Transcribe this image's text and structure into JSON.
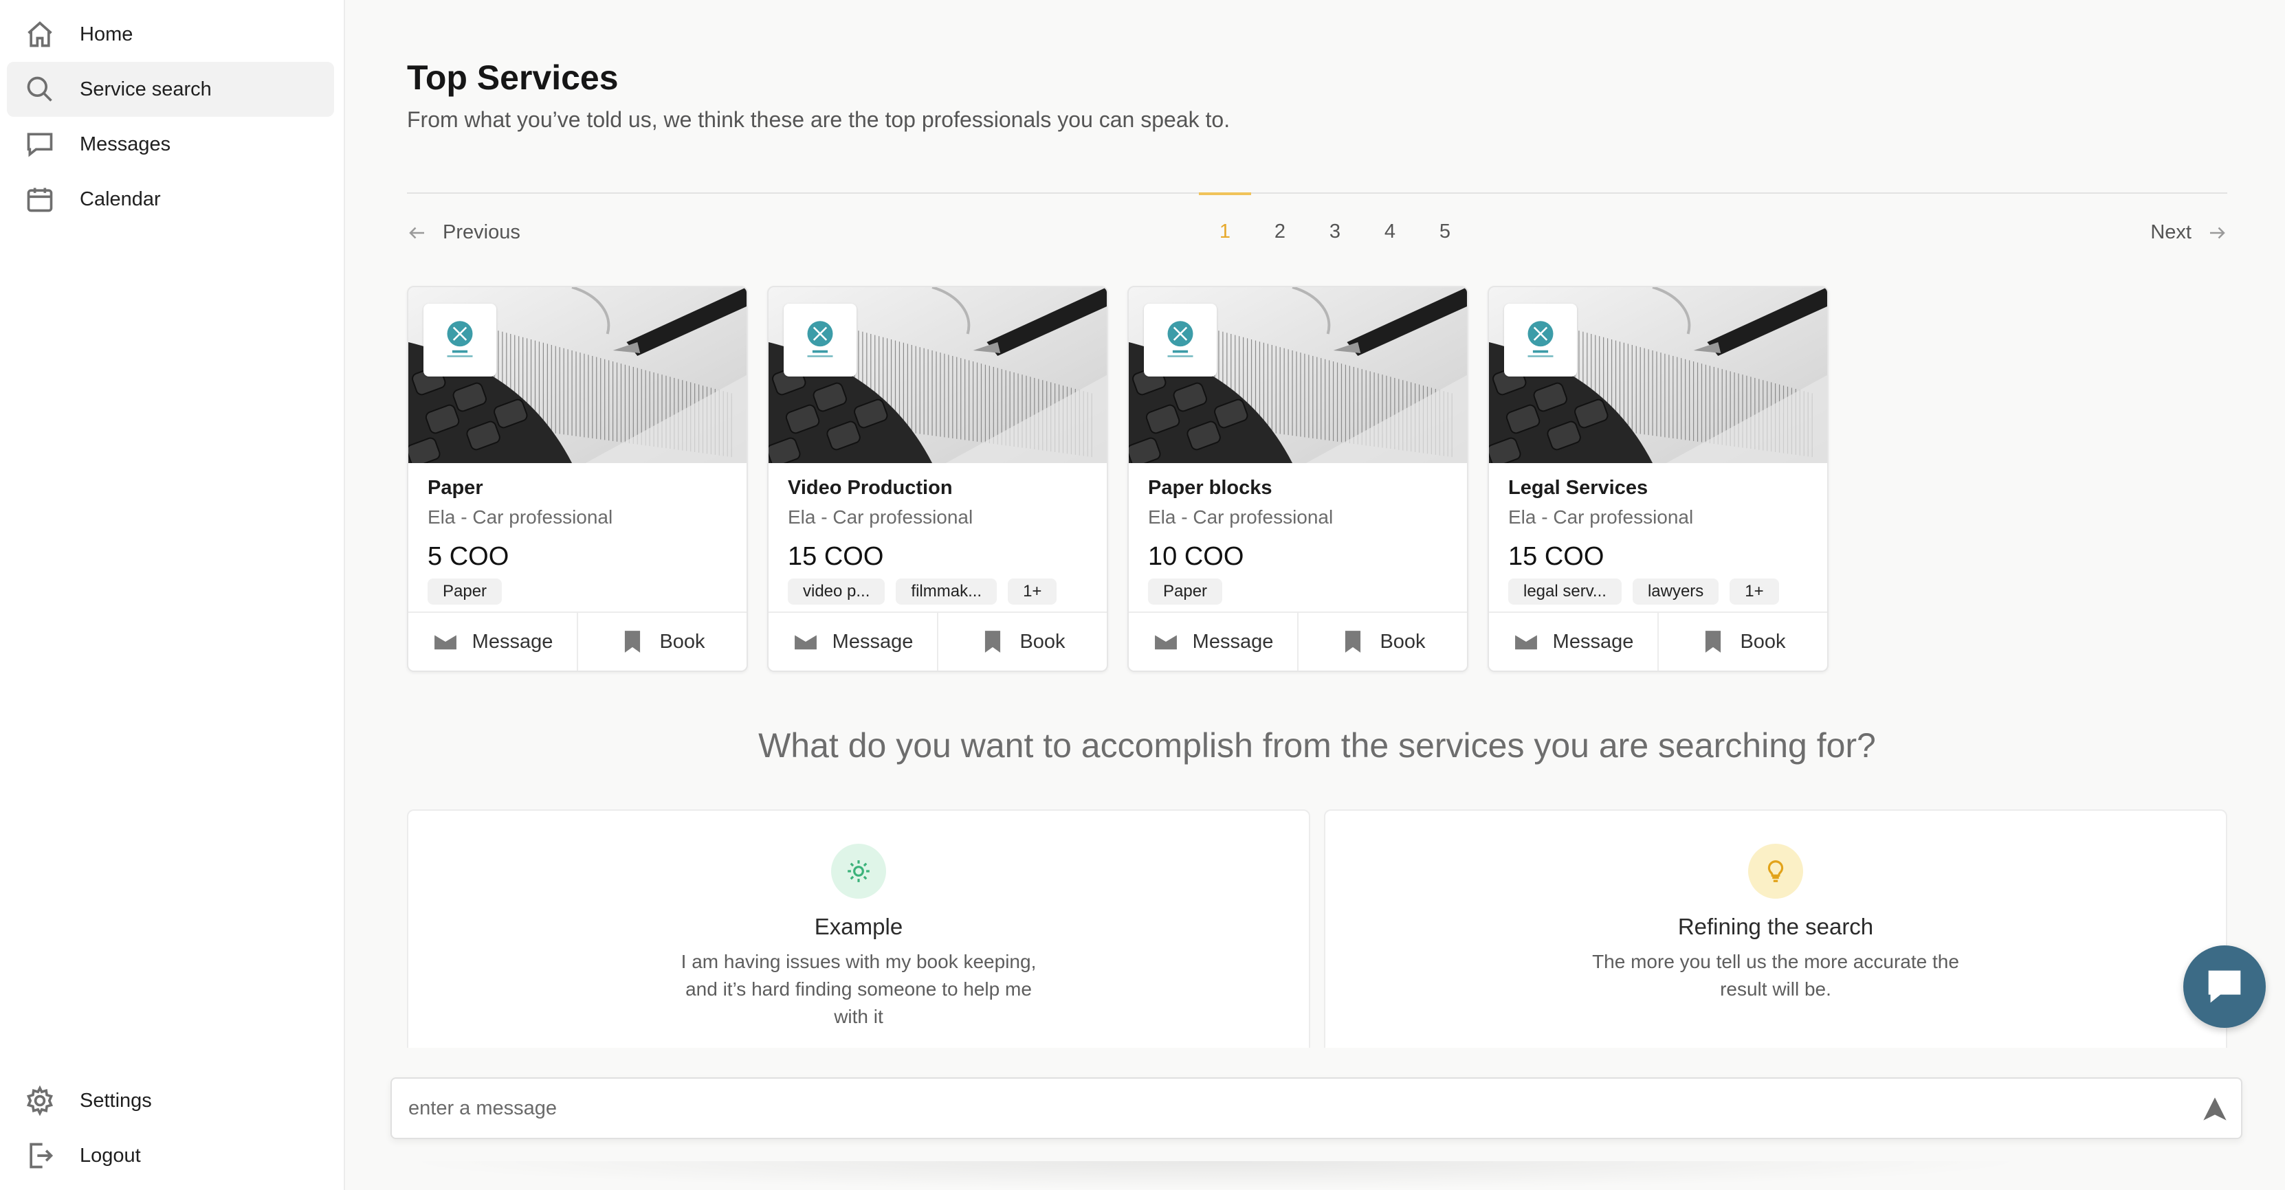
{
  "sidebar": {
    "items": [
      {
        "label": "Home",
        "icon": "home-icon"
      },
      {
        "label": "Service search",
        "icon": "search-icon",
        "active": true
      },
      {
        "label": "Messages",
        "icon": "chat-bubble-icon"
      },
      {
        "label": "Calendar",
        "icon": "calendar-icon"
      }
    ],
    "bottom_items": [
      {
        "label": "Settings",
        "icon": "gear-icon"
      },
      {
        "label": "Logout",
        "icon": "logout-icon"
      }
    ]
  },
  "header": {
    "title": "Top Services",
    "subtitle": "From what you’ve told us, we think these are the top professionals you can speak to."
  },
  "pagination": {
    "previous_label": "Previous",
    "next_label": "Next",
    "pages": [
      "1",
      "2",
      "3",
      "4",
      "5"
    ],
    "current_page": "1"
  },
  "cards": [
    {
      "title": "Paper",
      "subtitle": "Ela - Car professional",
      "price": "5 COO",
      "tags": [
        "Paper"
      ],
      "message_label": "Message",
      "book_label": "Book"
    },
    {
      "title": "Video Production",
      "subtitle": "Ela - Car professional",
      "price": "15 COO",
      "tags": [
        "video p...",
        "filmmak...",
        "1+"
      ],
      "message_label": "Message",
      "book_label": "Book"
    },
    {
      "title": "Paper blocks",
      "subtitle": "Ela - Car professional",
      "price": "10 COO",
      "tags": [
        "Paper"
      ],
      "message_label": "Message",
      "book_label": "Book"
    },
    {
      "title": "Legal Services",
      "subtitle": "Ela - Car professional",
      "price": "15 COO",
      "tags": [
        "legal serv...",
        "lawyers",
        "1+"
      ],
      "message_label": "Message",
      "book_label": "Book"
    }
  ],
  "question": "What do you want to accomplish from the services you are searching for?",
  "info_cards": [
    {
      "title": "Example",
      "text": "I am having issues with my book keeping, and it’s hard finding someone to help me with it",
      "icon": "sun-icon",
      "bubble_color": "#dff5e8",
      "icon_color": "#3bb27a"
    },
    {
      "title": "Refining the search",
      "text": "The more you tell us the more accurate the result will be.",
      "icon": "lightbulb-icon",
      "bubble_color": "#fbf0c6",
      "icon_color": "#e2a31a"
    }
  ],
  "message_bar": {
    "placeholder": "enter a message"
  },
  "colors": {
    "accent": "#f0c35a",
    "fab": "#3c6b86",
    "logo_teal": "#3c9ca8"
  }
}
